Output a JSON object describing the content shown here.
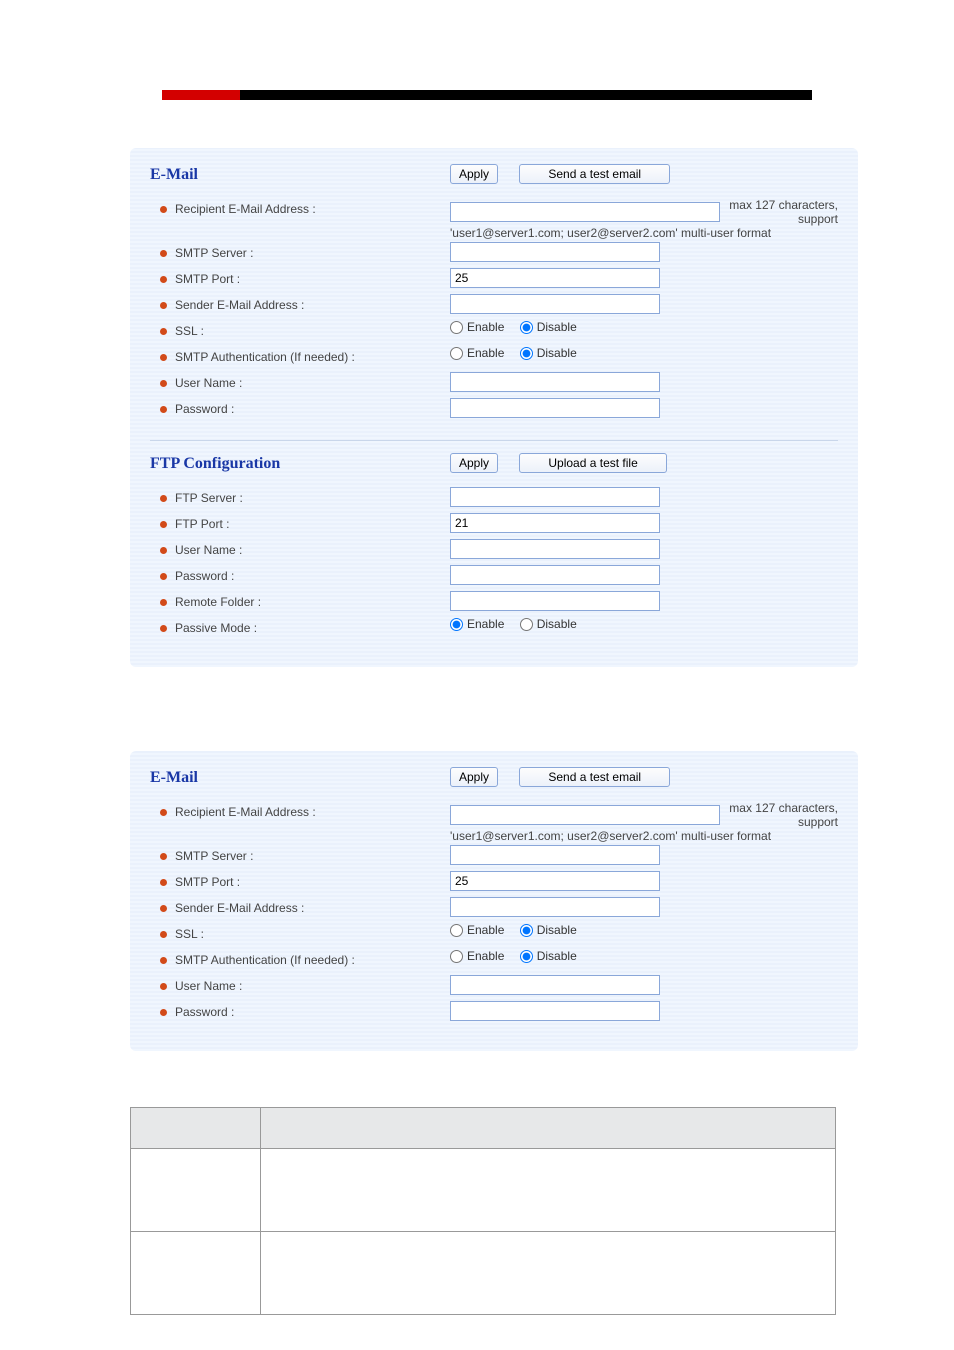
{
  "lang": "English",
  "email": {
    "title": "E-Mail",
    "apply_btn": "Apply",
    "test_btn": "Send a test email",
    "recipient_label": "Recipient E-Mail Address :",
    "recipient_value": "",
    "recipient_note_1": "max 127 characters, support",
    "recipient_note_2": "'user1@server1.com; user2@server2.com' multi-user format",
    "smtp_server_label": "SMTP Server :",
    "smtp_server_value": "",
    "smtp_port_label": "SMTP Port :",
    "smtp_port_value": "25",
    "sender_label": "Sender E-Mail Address :",
    "sender_value": "",
    "ssl_label": "SSL :",
    "ssl_enable": "Enable",
    "ssl_disable": "Disable",
    "ssl_selected": "disable",
    "auth_label": "SMTP Authentication (If needed) :",
    "auth_enable": "Enable",
    "auth_disable": "Disable",
    "auth_selected": "disable",
    "username_label": "User Name :",
    "username_value": "",
    "password_label": "Password :",
    "password_value": ""
  },
  "ftp": {
    "title": "FTP Configuration",
    "apply_btn": "Apply",
    "test_btn": "Upload a test file",
    "server_label": "FTP Server :",
    "server_value": "",
    "port_label": "FTP Port :",
    "port_value": "21",
    "username_label": "User Name :",
    "username_value": "",
    "password_label": "Password :",
    "password_value": "",
    "folder_label": "Remote Folder :",
    "folder_value": "",
    "passive_label": "Passive Mode :",
    "passive_enable": "Enable",
    "passive_disable": "Disable",
    "passive_selected": "enable"
  }
}
